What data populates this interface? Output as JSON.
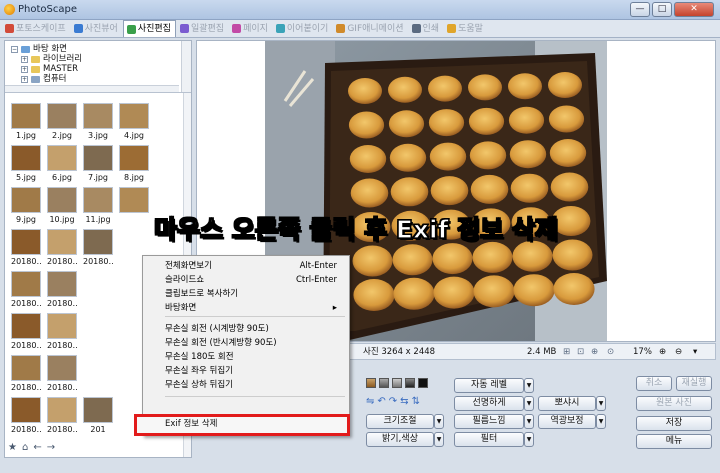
{
  "app": {
    "title": "PhotoScape",
    "min": "—",
    "max": "□",
    "close": "✕"
  },
  "tabs": [
    {
      "label": "포토스케이프",
      "color": "#d24b3a",
      "active": false
    },
    {
      "label": "사진뷰어",
      "color": "#3a7bd2",
      "active": false
    },
    {
      "label": "사진편집",
      "color": "#3a9f4a",
      "active": true
    },
    {
      "label": "일괄편집",
      "color": "#7a5bd0",
      "active": false
    },
    {
      "label": "페이지",
      "color": "#c24aa6",
      "active": false
    },
    {
      "label": "이어붙이기",
      "color": "#3aa3b8",
      "active": false
    },
    {
      "label": "GIF애니메이션",
      "color": "#d08a2a",
      "active": false
    },
    {
      "label": "인쇄",
      "color": "#5a6a80",
      "active": false
    },
    {
      "label": "도움말",
      "color": "#e0a52a",
      "active": false
    }
  ],
  "tree": [
    "바탕 화면",
    "라이브러리",
    "MASTER",
    "컴퓨터"
  ],
  "thumbnails": [
    "1.jpg",
    "2.jpg",
    "3.jpg",
    "4.jpg",
    "5.jpg",
    "6.jpg",
    "7.jpg",
    "8.jpg",
    "9.jpg",
    "10.jpg",
    "11.jpg",
    "",
    "20180…",
    "20180…",
    "20180…",
    "",
    "20180…",
    "20180…",
    "",
    "",
    "20180…",
    "20180…",
    "",
    "",
    "20180…",
    "20180…",
    "",
    "",
    "20180…",
    "20180…",
    "201",
    ""
  ],
  "context_menu": [
    {
      "label": "전체화면보기",
      "shortcut": "Alt-Enter"
    },
    {
      "label": "슬라이드쇼",
      "shortcut": "Ctrl-Enter"
    },
    {
      "label": "클립보드로 복사하기",
      "shortcut": ""
    },
    {
      "label": "바탕화면",
      "shortcut": "▸"
    },
    {
      "label": "무손실 회전 (시계방향 90도)",
      "shortcut": ""
    },
    {
      "label": "무손실 회전 (반시계방향 90도)",
      "shortcut": ""
    },
    {
      "label": "무손실 180도 회전",
      "shortcut": ""
    },
    {
      "label": "무손실 좌우 뒤집기",
      "shortcut": ""
    },
    {
      "label": "무손실 상하 뒤집기",
      "shortcut": ""
    }
  ],
  "exif_item": "Exif 정보 삭제",
  "overlay_caption": "마우스 오른쪽 클릭 후 Exif 정보 삭제",
  "status": {
    "dimensions": "사진 3264 x 2448",
    "filesize": "2.4 MB",
    "zoom": "17%"
  },
  "edit_buttons": {
    "auto_level": "자동 레벨",
    "sharpen": "선명하게",
    "resize": "크기조절",
    "film_effect": "필름느낌",
    "brightness": "밝기,색상",
    "filter": "필터",
    "vignette": "뽀샤시",
    "backlight": "역광보정"
  },
  "right_buttons": {
    "cancel": "취소",
    "redo": "재실행",
    "original": "원본 사진",
    "save": "저장",
    "menu": "메뉴"
  }
}
